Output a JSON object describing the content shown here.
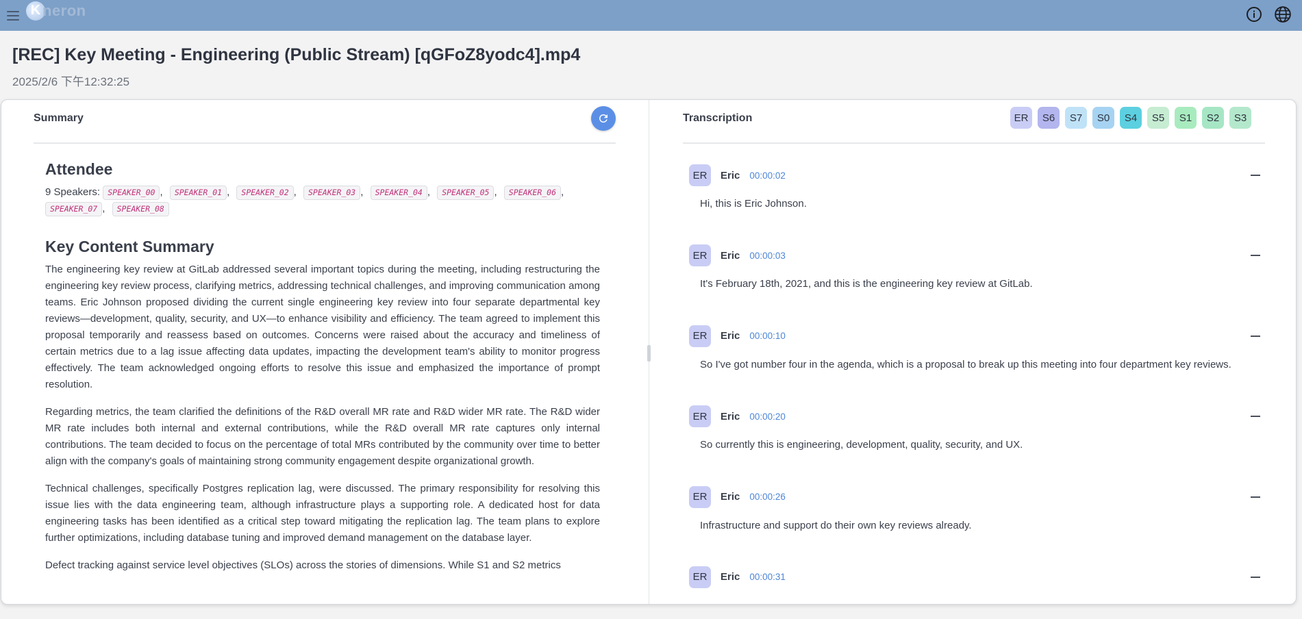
{
  "app": {
    "logo_letter": "K",
    "logo_text": "neron"
  },
  "header": {
    "title": "[REC] Key Meeting - Engineering (Public Stream) [qGFoZ8yodc4].mp4",
    "date": "2025/2/6 下午12:32:25"
  },
  "summary": {
    "panel_title": "Summary",
    "attendee_heading": "Attendee",
    "speakers_prefix": "9 Speakers:",
    "speakers": [
      "SPEAKER_00",
      "SPEAKER_01",
      "SPEAKER_02",
      "SPEAKER_03",
      "SPEAKER_04",
      "SPEAKER_05",
      "SPEAKER_06",
      "SPEAKER_07",
      "SPEAKER_08"
    ],
    "content_heading": "Key Content Summary",
    "paragraphs": [
      "The engineering key review at GitLab addressed several important topics during the meeting, including restructuring the engineering key review process, clarifying metrics, addressing technical challenges, and improving communication among teams. Eric Johnson proposed dividing the current single engineering key review into four separate departmental key reviews—development, quality, security, and UX—to enhance visibility and efficiency. The team agreed to implement this proposal temporarily and reassess based on outcomes. Concerns were raised about the accuracy and timeliness of certain metrics due to a lag issue affecting data updates, impacting the development team's ability to monitor progress effectively. The team acknowledged ongoing efforts to resolve this issue and emphasized the importance of prompt resolution.",
      "Regarding metrics, the team clarified the definitions of the R&D overall MR rate and R&D wider MR rate. The R&D wider MR rate includes both internal and external contributions, while the R&D overall MR rate captures only internal contributions. The team decided to focus on the percentage of total MRs contributed by the community over time to better align with the company's goals of maintaining strong community engagement despite organizational growth.",
      "Technical challenges, specifically Postgres replication lag, were discussed. The primary responsibility for resolving this issue lies with the data engineering team, although infrastructure plays a supporting role. A dedicated host for data engineering tasks has been identified as a critical step toward mitigating the replication lag. The team plans to explore further optimizations, including database tuning and improved demand management on the database layer.",
      "Defect tracking against service level objectives (SLOs) across the stories of dimensions. While S1 and S2 metrics"
    ]
  },
  "transcription": {
    "panel_title": "Transcription",
    "speaker_chips": [
      {
        "label": "ER",
        "color": "#c9cdf5"
      },
      {
        "label": "S6",
        "color": "#b3b5ee"
      },
      {
        "label": "S7",
        "color": "#bfe2f7"
      },
      {
        "label": "S0",
        "color": "#a6d3f2"
      },
      {
        "label": "S4",
        "color": "#5cd0e0"
      },
      {
        "label": "S5",
        "color": "#c6ecd2"
      },
      {
        "label": "S1",
        "color": "#a8ebbe"
      },
      {
        "label": "S2",
        "color": "#a6e6c4"
      },
      {
        "label": "S3",
        "color": "#b4e8cc"
      }
    ],
    "entries": [
      {
        "avatar": "ER",
        "speaker": "Eric",
        "time": "00:00:02",
        "text": "Hi, this is Eric Johnson."
      },
      {
        "avatar": "ER",
        "speaker": "Eric",
        "time": "00:00:03",
        "text": "It's February 18th, 2021, and this is the engineering key review at GitLab."
      },
      {
        "avatar": "ER",
        "speaker": "Eric",
        "time": "00:00:10",
        "text": "So I've got number four in the agenda, which is a proposal to break up this meeting into four department key reviews."
      },
      {
        "avatar": "ER",
        "speaker": "Eric",
        "time": "00:00:20",
        "text": "So currently this is engineering, development, quality, security, and UX."
      },
      {
        "avatar": "ER",
        "speaker": "Eric",
        "time": "00:00:26",
        "text": "Infrastructure and support do their own key reviews already."
      },
      {
        "avatar": "ER",
        "speaker": "Eric",
        "time": "00:00:31",
        "text": ""
      }
    ]
  }
}
